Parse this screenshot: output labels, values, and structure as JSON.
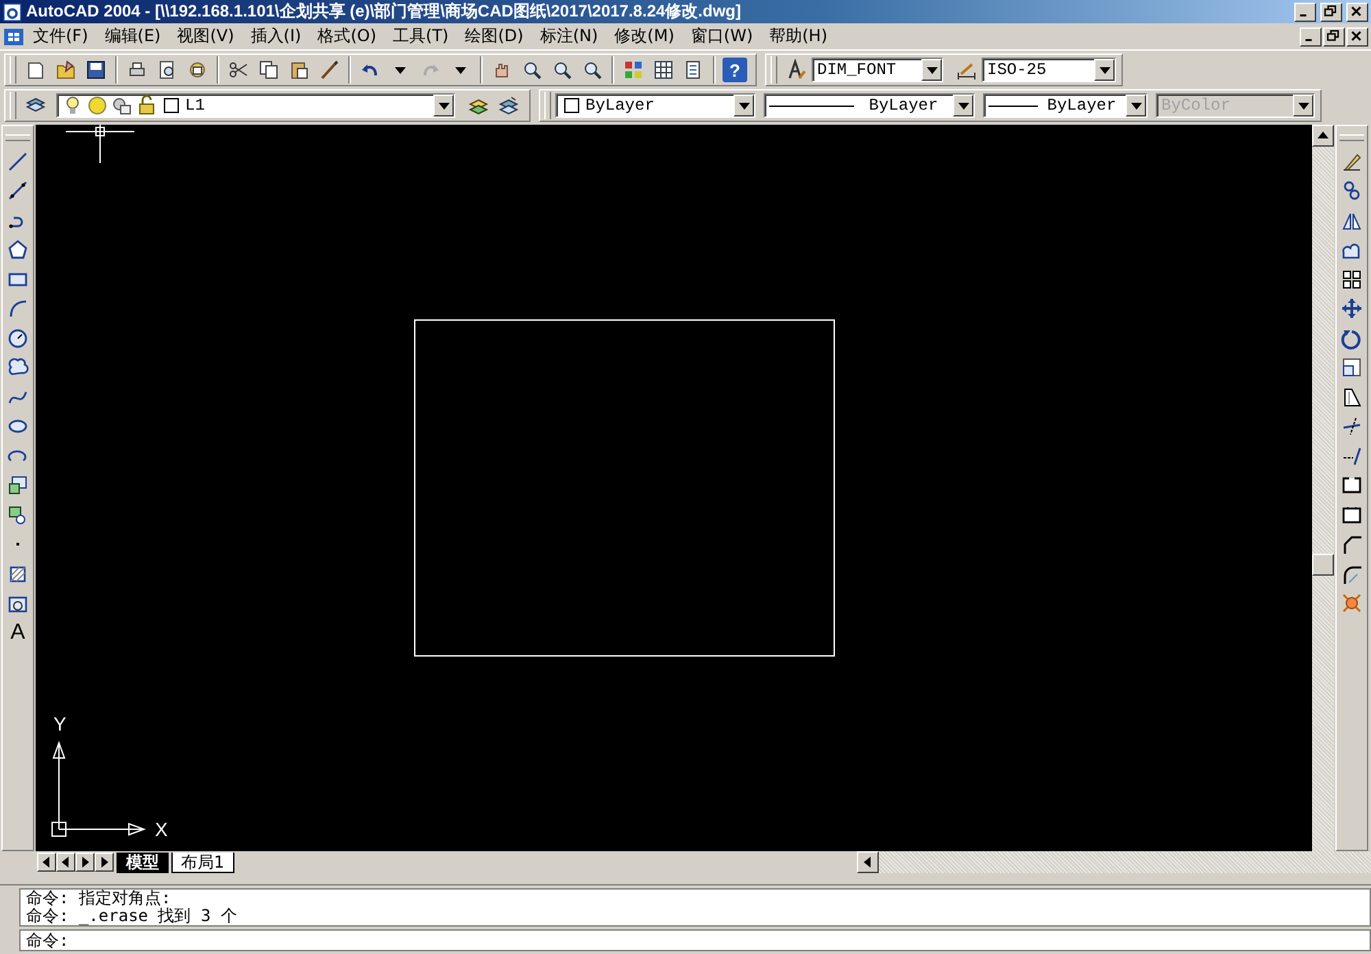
{
  "window": {
    "title": "AutoCAD 2004 - [\\\\192.168.1.101\\企划共享 (e)\\部门管理\\商场CAD图纸\\2017\\2017.8.24修改.dwg]"
  },
  "menu": [
    "文件(F)",
    "编辑(E)",
    "视图(V)",
    "插入(I)",
    "格式(O)",
    "工具(T)",
    "绘图(D)",
    "标注(N)",
    "修改(M)",
    "窗口(W)",
    "帮助(H)"
  ],
  "standard_toolbar": {
    "help": "?",
    "text_style": "DIM_FONT",
    "dim_style": "ISO-25"
  },
  "layers_toolbar": {
    "layer": "L1"
  },
  "properties_toolbar": {
    "color_control": "ByLayer",
    "linetype": "ByLayer",
    "lineweight": "ByLayer",
    "plot_style": {
      "value": "ByColor",
      "disabled": true
    }
  },
  "draw_toolbar": {
    "text_tool": "A"
  },
  "canvas": {
    "ucs": {
      "x_label": "X",
      "y_label": "Y"
    }
  },
  "layout_tabs": [
    {
      "label": "模型",
      "selected": true
    },
    {
      "label": "布局1",
      "selected": false
    }
  ],
  "command_history": [
    "命令: 指定对角点:",
    "命令: _.erase 找到 3 个"
  ],
  "command_prompt": "命令:"
}
